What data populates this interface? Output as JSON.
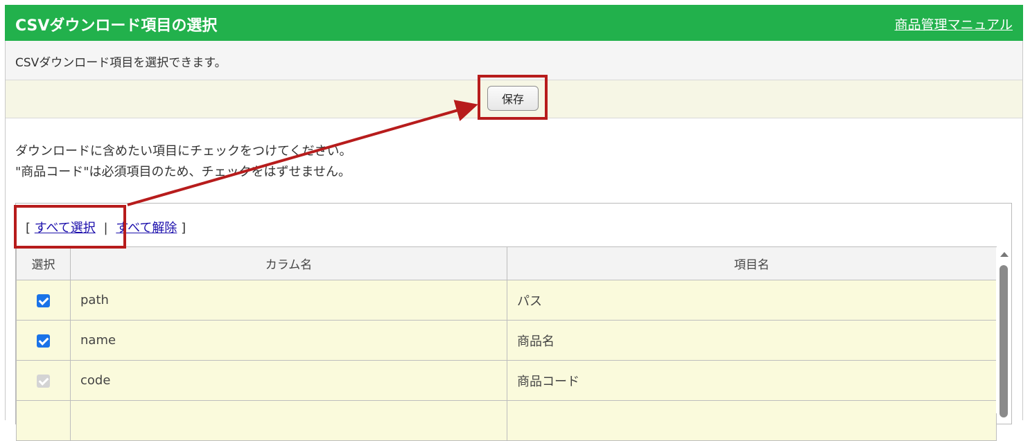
{
  "header": {
    "title": "CSVダウンロード項目の選択",
    "manual_link": "商品管理マニュアル"
  },
  "description": "CSVダウンロード項目を選択できます。",
  "save_button": "保存",
  "notes": [
    "ダウンロードに含めたい項目にチェックをつけてください。",
    "\"商品コード\"は必須項目のため、チェックをはずせません。"
  ],
  "select_links": {
    "open_bracket": "[",
    "select_all": "すべて選択",
    "separator": "|",
    "deselect_all": "すべて解除",
    "close_bracket": "]"
  },
  "table": {
    "headers": [
      "選択",
      "カラム名",
      "項目名"
    ],
    "rows": [
      {
        "checked": true,
        "disabled": false,
        "column": "path",
        "item": "パス"
      },
      {
        "checked": true,
        "disabled": false,
        "column": "name",
        "item": "商品名"
      },
      {
        "checked": true,
        "disabled": true,
        "column": "code",
        "item": "商品コード"
      },
      {
        "checked": false,
        "disabled": false,
        "column": "",
        "item": ""
      }
    ]
  },
  "colors": {
    "header_bg": "#22b14c",
    "highlight": "#b71c1c",
    "checkbox": "#1a73e8",
    "row_bg": "#fafadc"
  }
}
